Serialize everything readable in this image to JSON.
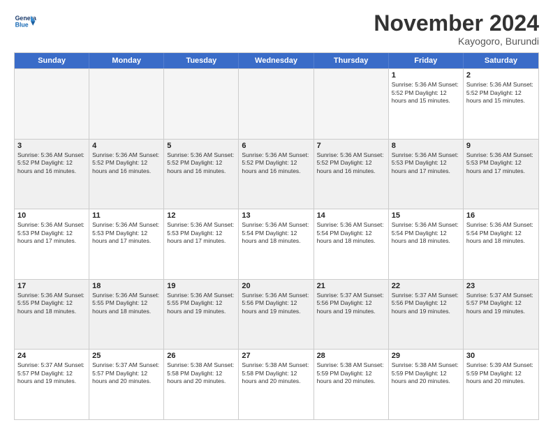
{
  "header": {
    "logo_line1": "General",
    "logo_line2": "Blue",
    "month": "November 2024",
    "location": "Kayogoro, Burundi"
  },
  "days_of_week": [
    "Sunday",
    "Monday",
    "Tuesday",
    "Wednesday",
    "Thursday",
    "Friday",
    "Saturday"
  ],
  "weeks": [
    [
      {
        "day": "",
        "info": "",
        "empty": true
      },
      {
        "day": "",
        "info": "",
        "empty": true
      },
      {
        "day": "",
        "info": "",
        "empty": true
      },
      {
        "day": "",
        "info": "",
        "empty": true
      },
      {
        "day": "",
        "info": "",
        "empty": true
      },
      {
        "day": "1",
        "info": "Sunrise: 5:36 AM\nSunset: 5:52 PM\nDaylight: 12 hours\nand 15 minutes."
      },
      {
        "day": "2",
        "info": "Sunrise: 5:36 AM\nSunset: 5:52 PM\nDaylight: 12 hours\nand 15 minutes."
      }
    ],
    [
      {
        "day": "3",
        "info": "Sunrise: 5:36 AM\nSunset: 5:52 PM\nDaylight: 12 hours\nand 16 minutes."
      },
      {
        "day": "4",
        "info": "Sunrise: 5:36 AM\nSunset: 5:52 PM\nDaylight: 12 hours\nand 16 minutes."
      },
      {
        "day": "5",
        "info": "Sunrise: 5:36 AM\nSunset: 5:52 PM\nDaylight: 12 hours\nand 16 minutes."
      },
      {
        "day": "6",
        "info": "Sunrise: 5:36 AM\nSunset: 5:52 PM\nDaylight: 12 hours\nand 16 minutes."
      },
      {
        "day": "7",
        "info": "Sunrise: 5:36 AM\nSunset: 5:52 PM\nDaylight: 12 hours\nand 16 minutes."
      },
      {
        "day": "8",
        "info": "Sunrise: 5:36 AM\nSunset: 5:53 PM\nDaylight: 12 hours\nand 17 minutes."
      },
      {
        "day": "9",
        "info": "Sunrise: 5:36 AM\nSunset: 5:53 PM\nDaylight: 12 hours\nand 17 minutes."
      }
    ],
    [
      {
        "day": "10",
        "info": "Sunrise: 5:36 AM\nSunset: 5:53 PM\nDaylight: 12 hours\nand 17 minutes."
      },
      {
        "day": "11",
        "info": "Sunrise: 5:36 AM\nSunset: 5:53 PM\nDaylight: 12 hours\nand 17 minutes."
      },
      {
        "day": "12",
        "info": "Sunrise: 5:36 AM\nSunset: 5:53 PM\nDaylight: 12 hours\nand 17 minutes."
      },
      {
        "day": "13",
        "info": "Sunrise: 5:36 AM\nSunset: 5:54 PM\nDaylight: 12 hours\nand 18 minutes."
      },
      {
        "day": "14",
        "info": "Sunrise: 5:36 AM\nSunset: 5:54 PM\nDaylight: 12 hours\nand 18 minutes."
      },
      {
        "day": "15",
        "info": "Sunrise: 5:36 AM\nSunset: 5:54 PM\nDaylight: 12 hours\nand 18 minutes."
      },
      {
        "day": "16",
        "info": "Sunrise: 5:36 AM\nSunset: 5:54 PM\nDaylight: 12 hours\nand 18 minutes."
      }
    ],
    [
      {
        "day": "17",
        "info": "Sunrise: 5:36 AM\nSunset: 5:55 PM\nDaylight: 12 hours\nand 18 minutes."
      },
      {
        "day": "18",
        "info": "Sunrise: 5:36 AM\nSunset: 5:55 PM\nDaylight: 12 hours\nand 18 minutes."
      },
      {
        "day": "19",
        "info": "Sunrise: 5:36 AM\nSunset: 5:55 PM\nDaylight: 12 hours\nand 19 minutes."
      },
      {
        "day": "20",
        "info": "Sunrise: 5:36 AM\nSunset: 5:56 PM\nDaylight: 12 hours\nand 19 minutes."
      },
      {
        "day": "21",
        "info": "Sunrise: 5:37 AM\nSunset: 5:56 PM\nDaylight: 12 hours\nand 19 minutes."
      },
      {
        "day": "22",
        "info": "Sunrise: 5:37 AM\nSunset: 5:56 PM\nDaylight: 12 hours\nand 19 minutes."
      },
      {
        "day": "23",
        "info": "Sunrise: 5:37 AM\nSunset: 5:57 PM\nDaylight: 12 hours\nand 19 minutes."
      }
    ],
    [
      {
        "day": "24",
        "info": "Sunrise: 5:37 AM\nSunset: 5:57 PM\nDaylight: 12 hours\nand 19 minutes."
      },
      {
        "day": "25",
        "info": "Sunrise: 5:37 AM\nSunset: 5:57 PM\nDaylight: 12 hours\nand 20 minutes."
      },
      {
        "day": "26",
        "info": "Sunrise: 5:38 AM\nSunset: 5:58 PM\nDaylight: 12 hours\nand 20 minutes."
      },
      {
        "day": "27",
        "info": "Sunrise: 5:38 AM\nSunset: 5:58 PM\nDaylight: 12 hours\nand 20 minutes."
      },
      {
        "day": "28",
        "info": "Sunrise: 5:38 AM\nSunset: 5:59 PM\nDaylight: 12 hours\nand 20 minutes."
      },
      {
        "day": "29",
        "info": "Sunrise: 5:38 AM\nSunset: 5:59 PM\nDaylight: 12 hours\nand 20 minutes."
      },
      {
        "day": "30",
        "info": "Sunrise: 5:39 AM\nSunset: 5:59 PM\nDaylight: 12 hours\nand 20 minutes."
      }
    ]
  ]
}
